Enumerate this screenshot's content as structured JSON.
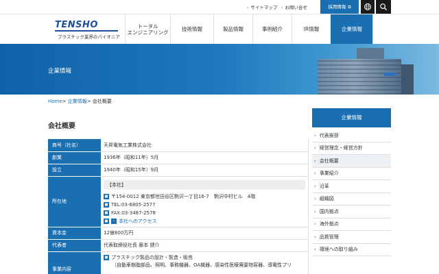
{
  "toplinks": {
    "sitemap": "サイトマップ",
    "contact": "お問い合せ",
    "recruit": "採用情報"
  },
  "logo": {
    "text": "TENSHO",
    "tagline": "プラスチック業界のパイオニア"
  },
  "nav": [
    {
      "label": "トータル\nエンジニアリング"
    },
    {
      "label": "技術情報"
    },
    {
      "label": "製品情報"
    },
    {
      "label": "事例紹介"
    },
    {
      "label": "IR情報"
    },
    {
      "label": "企業情報"
    }
  ],
  "hero": {
    "title": "企業情報"
  },
  "breadcrumb": {
    "home": "Home",
    "sep1": "> ",
    "section": "企業情報",
    "sep2": "> ",
    "current": "会社概要"
  },
  "page_title": "会社概要",
  "company": {
    "name_label": "商号（社名）",
    "name": "天昇電気工業株式会社",
    "founded_label": "創業",
    "founded": "1936年（昭和11年）5月",
    "established_label": "設立",
    "established": "1940年（昭和15年）9月",
    "location_label": "所在地",
    "hq_label": "【本社】",
    "address": "〒154-0012 東京都世田谷区駒沢一丁目16-7　駒沢中村ビル　4階",
    "tel": "TEL:03-6805-2577",
    "fax": "FAX:03-3487-2578",
    "access": "本社へのアクセス",
    "capital_label": "資本金",
    "capital": "12億800万円",
    "rep_label": "代表者",
    "rep": "代表取締役社長 藤本 健介",
    "business_label": "事業内容",
    "business_1": "プラスチック製品の設計・製造・販売",
    "business_1_detail": "（自動車樹脂部品、照明、事務機器、OA機器、感染性医療廃棄物容器、導電性プリ"
  },
  "sidebar": {
    "title": "企業情報",
    "items": [
      {
        "label": "代表挨拶"
      },
      {
        "label": "経営理念・経営方針"
      },
      {
        "label": "会社概要"
      },
      {
        "label": "事業紹介"
      },
      {
        "label": "沿革"
      },
      {
        "label": "組織図"
      },
      {
        "label": "国内拠点"
      },
      {
        "label": "海外拠点"
      },
      {
        "label": "品質管理"
      },
      {
        "label": "環境への取り組み"
      }
    ]
  },
  "colors": {
    "accent": "#1a6fb0",
    "logo": "#1a4f9c",
    "topbar_dark": "#1a1a1a"
  },
  "icons": {
    "link_arrow": "chevron-right-icon",
    "external": "external-link-icon",
    "globe": "globe-icon",
    "search": "search-icon"
  }
}
